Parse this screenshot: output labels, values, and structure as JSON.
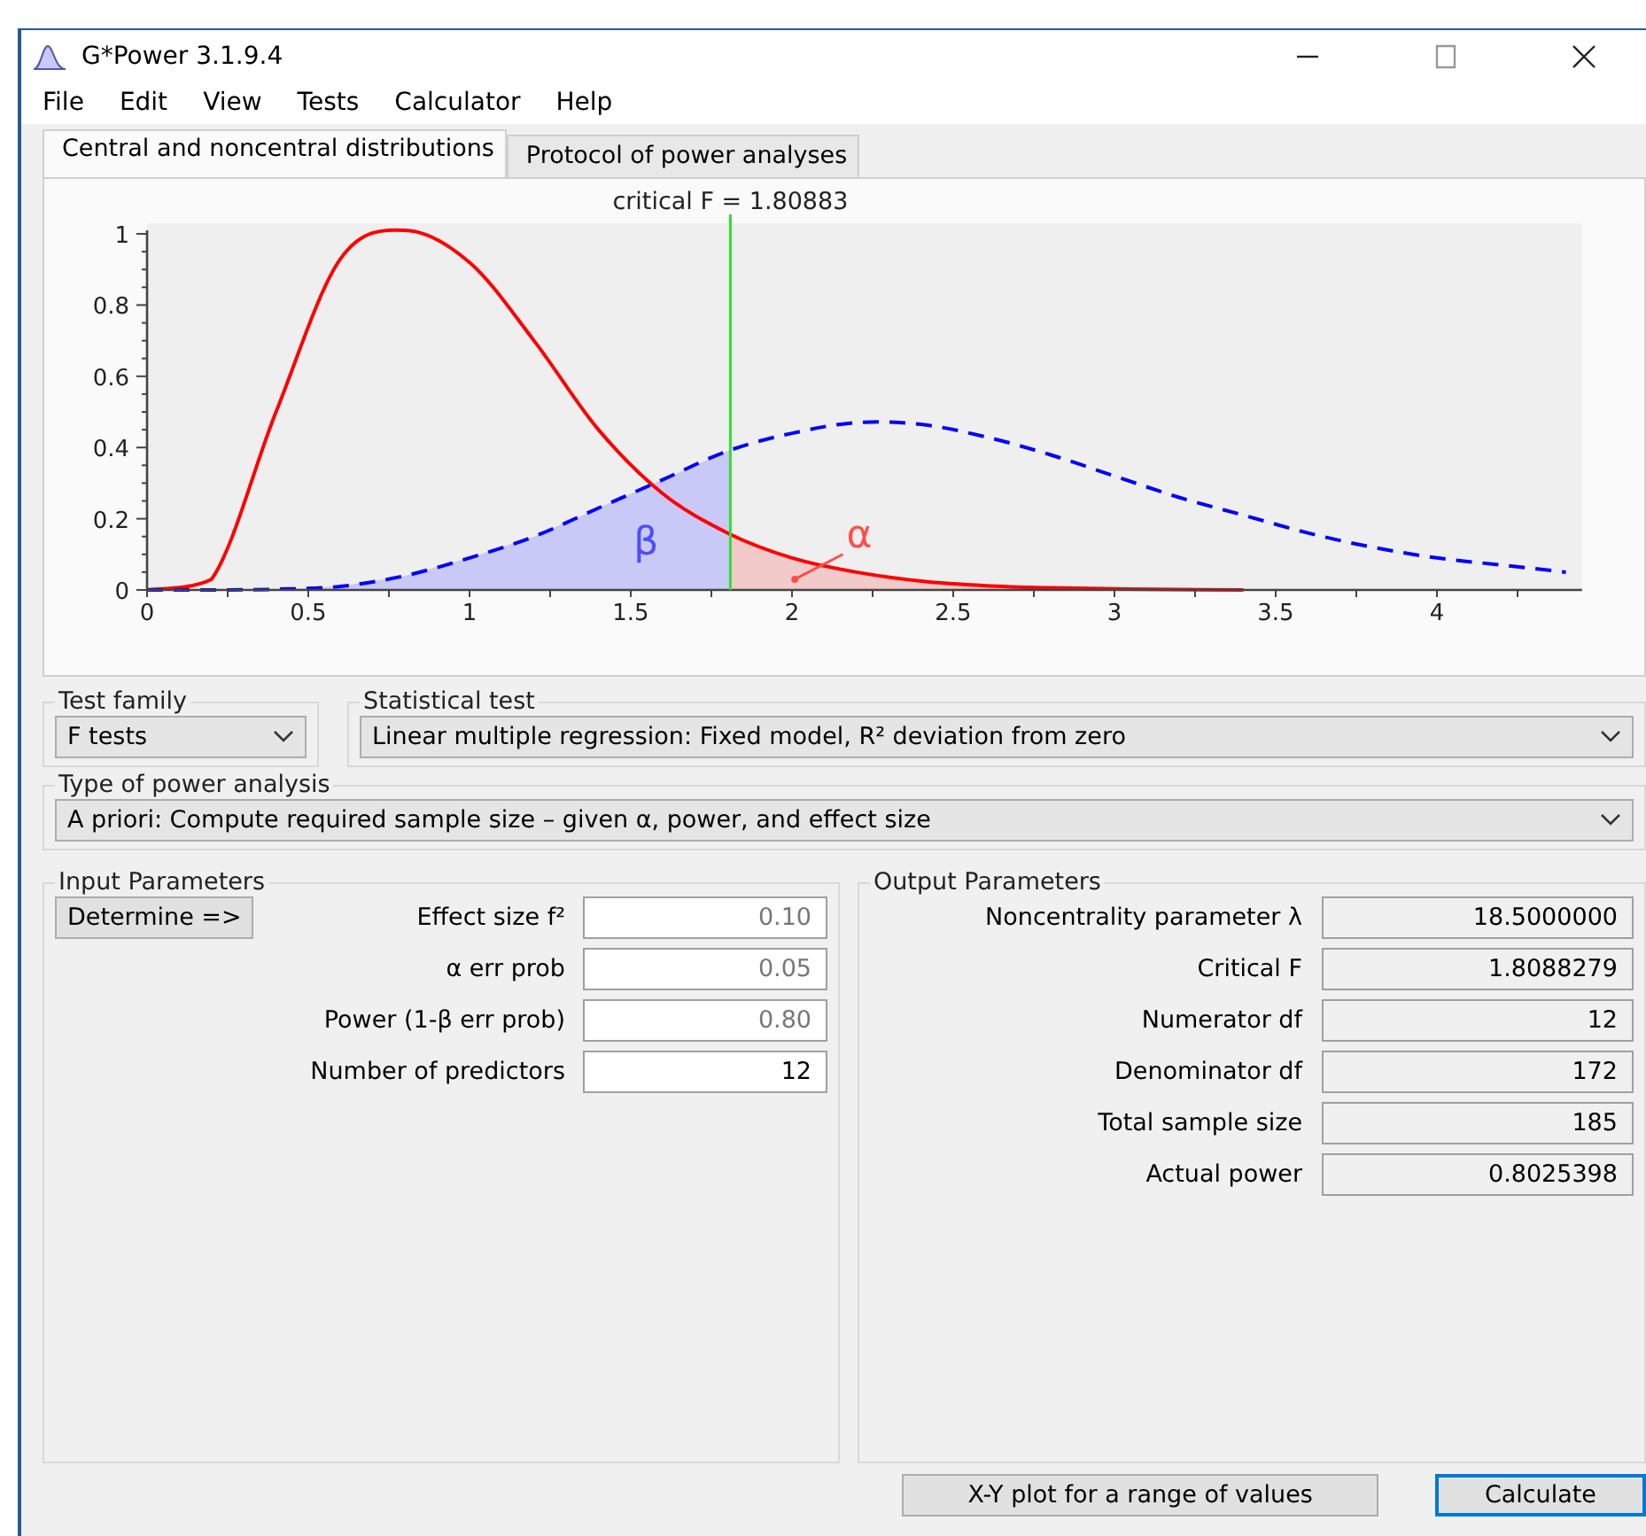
{
  "window": {
    "title": "G*Power 3.1.9.4"
  },
  "menu": [
    "File",
    "Edit",
    "View",
    "Tests",
    "Calculator",
    "Help"
  ],
  "tabs": [
    {
      "label": "Central and noncentral distributions",
      "selected": true
    },
    {
      "label": "Protocol of power analyses",
      "selected": false
    }
  ],
  "chart": {
    "chart_data": {
      "type": "line",
      "title": "critical F = 1.80883",
      "x": [
        0,
        0.2,
        0.4,
        0.6,
        0.8,
        1.0,
        1.2,
        1.4,
        1.6,
        1.8,
        2.0,
        2.2,
        2.4,
        2.6,
        2.8,
        3.0,
        3.2,
        3.4,
        3.6,
        3.8,
        4.0,
        4.2,
        4.4
      ],
      "series": [
        {
          "color": "#ff0000",
          "line_style": "solid",
          "values": [
            0,
            0.03,
            0.5,
            0.93,
            1.01,
            0.92,
            0.7,
            0.45,
            0.27,
            0.16,
            0.09,
            0.05,
            0.025,
            0.012,
            0.006,
            0.003,
            0.001,
            0,
            null,
            null,
            null,
            null,
            null
          ]
        },
        {
          "color": "#0000ff",
          "line_style": "dashed",
          "values": [
            0,
            0,
            0.002,
            0.01,
            0.04,
            0.09,
            0.15,
            0.23,
            0.31,
            0.39,
            0.44,
            0.47,
            0.465,
            0.43,
            0.38,
            0.32,
            0.26,
            0.21,
            0.16,
            0.12,
            0.09,
            0.07,
            0.05
          ]
        }
      ],
      "xlim": [
        0,
        4.45
      ],
      "ylim": [
        0,
        1.03
      ],
      "xticks": [
        0,
        0.5,
        1,
        1.5,
        2,
        2.5,
        3,
        3.5,
        4
      ],
      "yticks": [
        0,
        0.2,
        0.4,
        0.6,
        0.8,
        {
          "value": 1,
          "label": "1"
        }
      ],
      "ref_lines": [
        {
          "axis": "x",
          "value": 1.80883,
          "color": "#33dd33"
        }
      ],
      "annotations": [
        "β",
        "α"
      ]
    }
  },
  "test_family": {
    "label": "Test family",
    "value": "F tests"
  },
  "statistical_test": {
    "label": "Statistical test",
    "value": "Linear multiple regression: Fixed model, R² deviation from zero"
  },
  "power_analysis": {
    "label": "Type of power analysis",
    "value": "A priori: Compute required sample size – given α, power, and effect size"
  },
  "input_parameters": {
    "title": "Input Parameters",
    "determine_button": "Determine =>",
    "fields": [
      {
        "label": "Effect size f²",
        "value": "0.10",
        "dimmed": true
      },
      {
        "label": "α err prob",
        "value": "0.05",
        "dimmed": true
      },
      {
        "label": "Power (1-β err prob)",
        "value": "0.80",
        "dimmed": true
      },
      {
        "label": "Number of predictors",
        "value": "12",
        "dimmed": false
      }
    ]
  },
  "output_parameters": {
    "title": "Output Parameters",
    "fields": [
      {
        "label": "Noncentrality parameter λ",
        "value": "18.5000000"
      },
      {
        "label": "Critical F",
        "value": "1.8088279"
      },
      {
        "label": "Numerator df",
        "value": "12"
      },
      {
        "label": "Denominator df",
        "value": "172"
      },
      {
        "label": "Total sample size",
        "value": "185"
      },
      {
        "label": "Actual power",
        "value": "0.8025398"
      }
    ]
  },
  "buttons": [
    {
      "label": "X-Y plot for a range of values",
      "focused": false
    },
    {
      "label": "Calculate",
      "focused": true
    }
  ]
}
